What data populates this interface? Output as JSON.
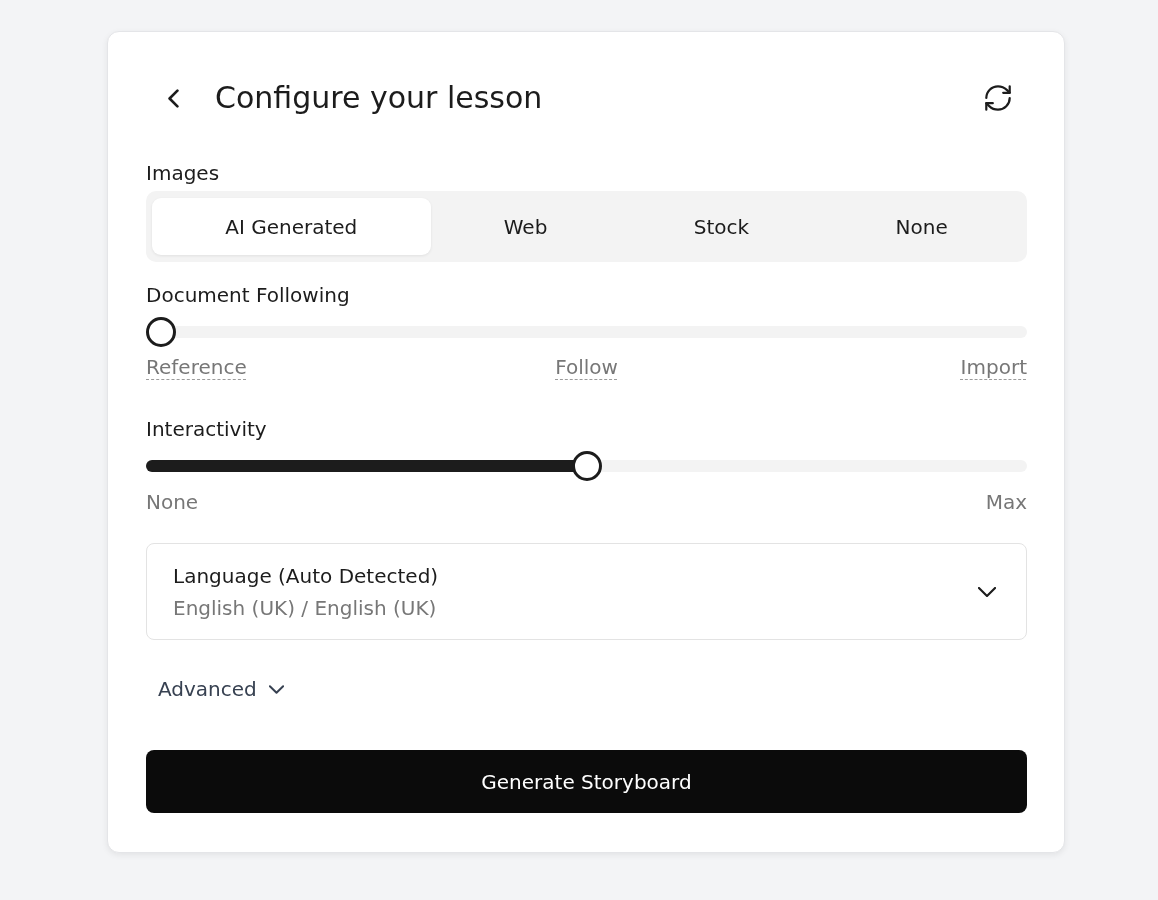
{
  "header": {
    "title": "Configure your lesson"
  },
  "images": {
    "label": "Images",
    "options": [
      {
        "label": "AI Generated",
        "selected": true
      },
      {
        "label": "Web",
        "selected": false
      },
      {
        "label": "Stock",
        "selected": false
      },
      {
        "label": "None",
        "selected": false
      }
    ]
  },
  "sliders": [
    {
      "label": "Document Following",
      "level": 0,
      "marks": [
        {
          "text": "Reference",
          "has_tooltip": true
        },
        {
          "text": "Follow",
          "has_tooltip": true
        },
        {
          "text": "Import",
          "has_tooltip": true
        }
      ]
    },
    {
      "label": "Interactivity",
      "level": 0.5,
      "marks": [
        {
          "text": "None",
          "has_tooltip": false
        },
        {
          "text": "Max",
          "has_tooltip": false
        }
      ]
    }
  ],
  "language": {
    "label": "Language (Auto Detected)",
    "value": "English (UK) / English (UK)"
  },
  "advanced": {
    "label": "Advanced",
    "expanded": false
  },
  "primary_button": {
    "label": "Generate Storyboard"
  }
}
